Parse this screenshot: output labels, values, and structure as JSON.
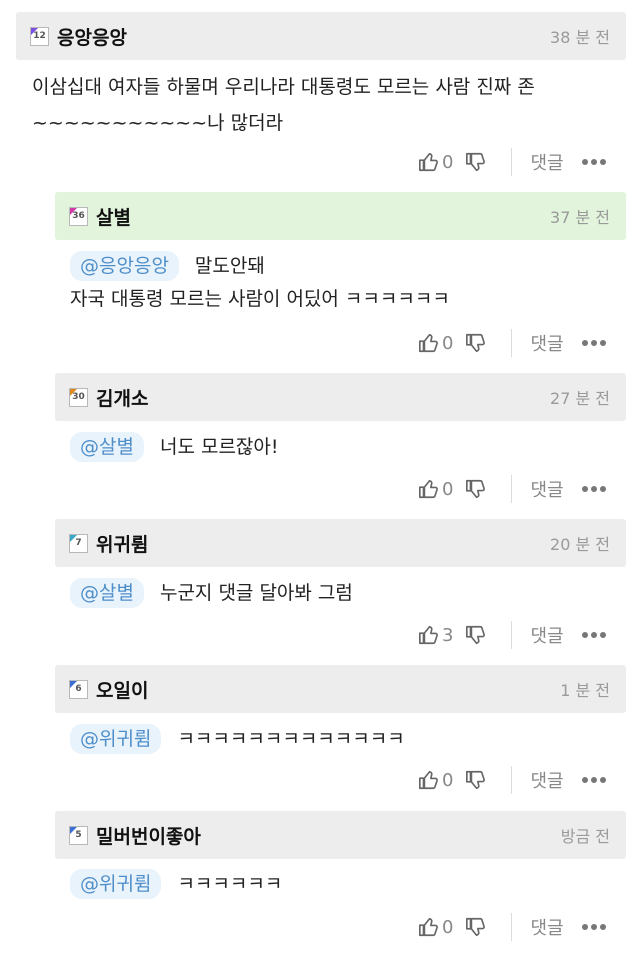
{
  "comments": [
    {
      "nick": "응앙응앙",
      "level": "12",
      "level_color": "#7b4fe0",
      "time": "38 분 전",
      "text_line1": "이삼십대 여자들 하물며 우리나라 대통령도 모르는 사람 진짜 존",
      "text_line2": "~~~~~~~~~~~나 많더라",
      "likes": "0",
      "reply_label": "댓글"
    },
    {
      "nick": "살별",
      "level": "36",
      "level_color": "#d43aa8",
      "time": "37 분 전",
      "mention": "@응앙응앙",
      "text_line1": "말도안돼",
      "text_line2": "자국 대통령 모르는 사람이 어딨어 ㅋㅋㅋㅋㅋㅋ",
      "likes": "0",
      "reply_label": "댓글"
    },
    {
      "nick": "김개소",
      "level": "30",
      "level_color": "#e08a1e",
      "time": "27 분 전",
      "mention": "@살별",
      "text_line1": "너도 모르잖아!",
      "likes": "0",
      "reply_label": "댓글"
    },
    {
      "nick": "위귀륌",
      "level": "7",
      "level_color": "#3aa7c9",
      "time": "20 분 전",
      "mention": "@살별",
      "text_line1": "누군지 댓글 달아봐 그럼",
      "likes": "3",
      "reply_label": "댓글"
    },
    {
      "nick": "오일이",
      "level": "6",
      "level_color": "#3b6fd6",
      "time": "1 분 전",
      "mention": "@위귀륌",
      "text_line1": "ㅋㅋㅋㅋㅋㅋㅋㅋㅋㅋㅋㅋㅋ",
      "likes": "0",
      "reply_label": "댓글"
    },
    {
      "nick": "밀버번이좋아",
      "level": "5",
      "level_color": "#3b6fd6",
      "time": "방금 전",
      "mention": "@위귀륌",
      "text_line1": "ㅋㅋㅋㅋㅋㅋ",
      "likes": "0",
      "reply_label": "댓글"
    }
  ],
  "icons": {
    "like": "thumbs-up-icon",
    "dislike": "thumbs-down-icon",
    "more": "more-dots-icon"
  }
}
